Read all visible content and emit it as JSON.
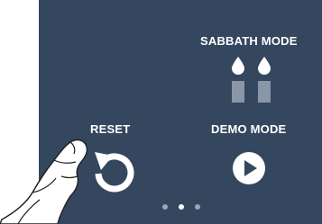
{
  "panel": {
    "background": "#34475f"
  },
  "sabbath_mode": {
    "label": "SABBATH MODE",
    "icon": "candles-icon"
  },
  "reset": {
    "label": "RESET",
    "icon": "reset-arrow-icon"
  },
  "demo_mode": {
    "label": "DEMO MODE",
    "icon": "play-icon"
  },
  "pagination": {
    "total_pages": 3,
    "active_page": 2
  },
  "overlay": {
    "icon": "pointing-hand-illustration"
  }
}
